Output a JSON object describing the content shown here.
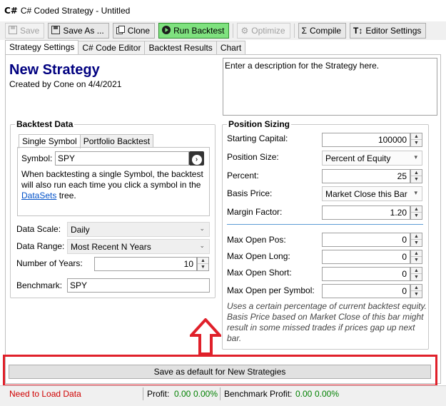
{
  "window": {
    "title": "C# Coded Strategy - Untitled",
    "app_icon": "C#"
  },
  "toolbar": {
    "save": "Save",
    "save_as": "Save As ...",
    "clone": "Clone",
    "run_backtest": "Run Backtest",
    "optimize": "Optimize",
    "compile": "Compile",
    "editor_settings": "Editor Settings",
    "colors": {
      "run_backtest": "#7fe27f"
    }
  },
  "tabs": [
    "Strategy Settings",
    "C# Code Editor",
    "Backtest Results",
    "Chart"
  ],
  "strategy": {
    "name": "New Strategy",
    "created_by": "Created by Cone on 4/4/2021",
    "description_placeholder": "Enter a description for the Strategy here."
  },
  "backtest_data": {
    "title": "Backtest Data",
    "subtabs": [
      "Single Symbol",
      "Portfolio Backtest"
    ],
    "symbol_label": "Symbol:",
    "symbol_value": "SPY",
    "help_text_before": "When backtesting a single Symbol, the backtest will also run each time you click a symbol in the ",
    "help_link": "DataSets",
    "help_text_after": " tree.",
    "data_scale_label": "Data Scale:",
    "data_scale_value": "Daily",
    "data_range_label": "Data Range:",
    "data_range_value": "Most Recent N Years",
    "num_years_label": "Number of Years:",
    "num_years_value": "10",
    "benchmark_label": "Benchmark:",
    "benchmark_value": "SPY"
  },
  "position_sizing": {
    "title": "Position Sizing",
    "starting_capital_label": "Starting Capital:",
    "starting_capital_value": "100000",
    "position_size_label": "Position Size:",
    "position_size_value": "Percent of Equity",
    "percent_label": "Percent:",
    "percent_value": "25",
    "basis_price_label": "Basis Price:",
    "basis_price_value": "Market Close this Bar",
    "margin_factor_label": "Margin Factor:",
    "margin_factor_value": "1.20",
    "max_open_pos_label": "Max Open Pos:",
    "max_open_pos_value": "0",
    "max_open_long_label": "Max Open Long:",
    "max_open_long_value": "0",
    "max_open_short_label": "Max Open Short:",
    "max_open_short_value": "0",
    "max_open_per_symbol_label": "Max Open per Symbol:",
    "max_open_per_symbol_value": "0",
    "note": "Uses a certain percentage of current backtest equity. Basis Price based on Market Close of this bar might result in some missed trades if prices gap up next bar."
  },
  "save_default_button": "Save as default for New Strategies",
  "status": {
    "need_data": "Need to Load Data",
    "profit_label": "Profit:",
    "profit_value": "0.00",
    "profit_pct": "0.00%",
    "benchmark_label": "Benchmark Profit:",
    "benchmark_value": "0.00",
    "benchmark_pct": "0.00%"
  },
  "colors": {
    "highlight": "#e0202a",
    "title": "#000080",
    "status_error": "#d00000",
    "status_ok": "#008000"
  }
}
